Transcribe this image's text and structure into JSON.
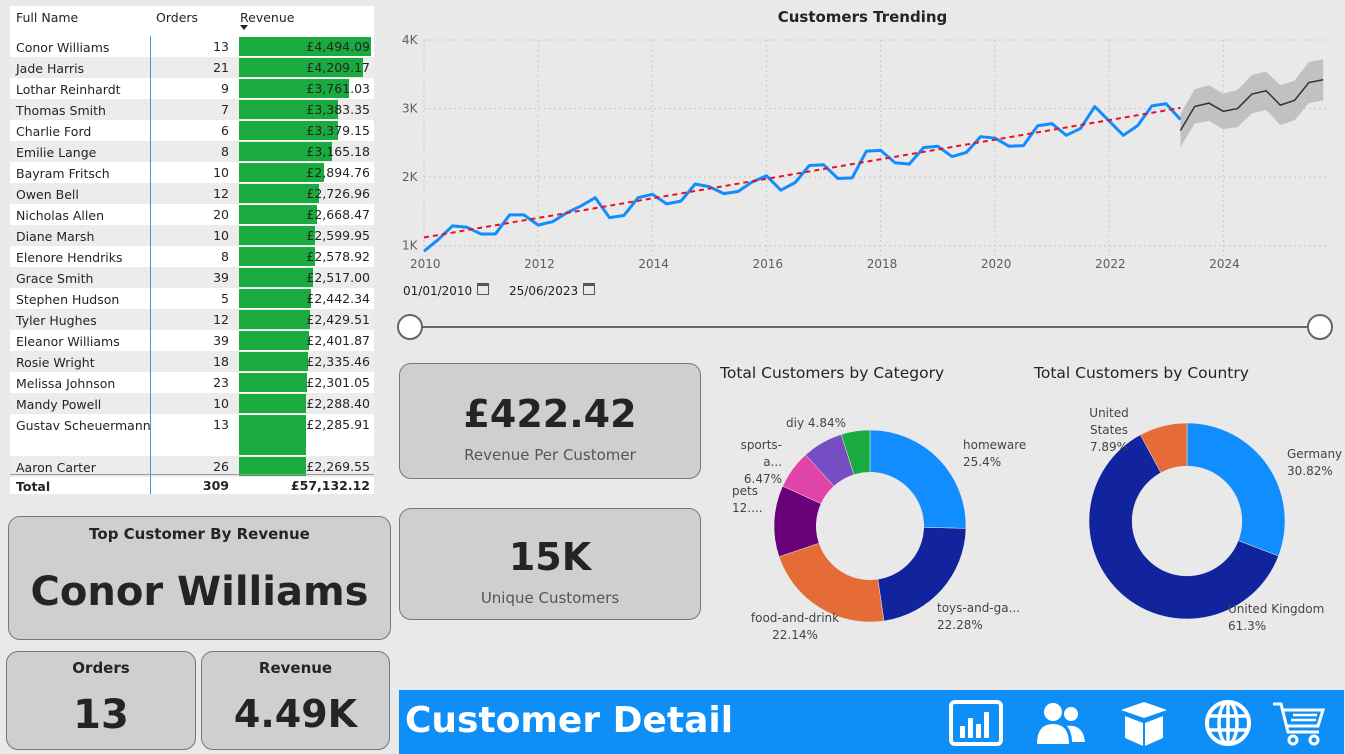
{
  "table": {
    "headers": {
      "name": "Full Name",
      "orders": "Orders",
      "revenue": "Revenue"
    },
    "rows": [
      {
        "name": "Conor Williams",
        "orders": "13",
        "revenue": "£4,494.09",
        "fill": 1.0
      },
      {
        "name": "Jade Harris",
        "orders": "21",
        "revenue": "£4,209.17",
        "fill": 0.937
      },
      {
        "name": "Lothar Reinhardt",
        "orders": "9",
        "revenue": "£3,761.03",
        "fill": 0.837
      },
      {
        "name": "Thomas Smith",
        "orders": "7",
        "revenue": "£3,383.35",
        "fill": 0.753
      },
      {
        "name": "Charlie Ford",
        "orders": "6",
        "revenue": "£3,379.15",
        "fill": 0.752
      },
      {
        "name": "Emilie Lange",
        "orders": "8",
        "revenue": "£3,165.18",
        "fill": 0.704
      },
      {
        "name": "Bayram Fritsch",
        "orders": "10",
        "revenue": "£2,894.76",
        "fill": 0.644
      },
      {
        "name": "Owen Bell",
        "orders": "12",
        "revenue": "£2,726.96",
        "fill": 0.607
      },
      {
        "name": "Nicholas Allen",
        "orders": "20",
        "revenue": "£2,668.47",
        "fill": 0.594
      },
      {
        "name": "Diane Marsh",
        "orders": "10",
        "revenue": "£2,599.95",
        "fill": 0.579
      },
      {
        "name": "Elenore Hendriks",
        "orders": "8",
        "revenue": "£2,578.92",
        "fill": 0.574
      },
      {
        "name": "Grace Smith",
        "orders": "39",
        "revenue": "£2,517.00",
        "fill": 0.56
      },
      {
        "name": "Stephen Hudson",
        "orders": "5",
        "revenue": "£2,442.34",
        "fill": 0.543
      },
      {
        "name": "Tyler Hughes",
        "orders": "12",
        "revenue": "£2,429.51",
        "fill": 0.541
      },
      {
        "name": "Eleanor Williams",
        "orders": "39",
        "revenue": "£2,401.87",
        "fill": 0.534
      },
      {
        "name": "Rosie Wright",
        "orders": "18",
        "revenue": "£2,335.46",
        "fill": 0.52
      },
      {
        "name": "Melissa Johnson",
        "orders": "23",
        "revenue": "£2,301.05",
        "fill": 0.512
      },
      {
        "name": "Mandy Powell",
        "orders": "10",
        "revenue": "£2,288.40",
        "fill": 0.509
      },
      {
        "name": "Gustav Scheuermann",
        "orders": "13",
        "revenue": "£2,285.91",
        "fill": 0.509
      },
      {
        "name": "Aaron Carter",
        "orders": "26",
        "revenue": "£2,269.55",
        "fill": 0.505
      }
    ],
    "total": {
      "label": "Total",
      "orders": "309",
      "revenue": "£57,132.12"
    }
  },
  "top_customer": {
    "title": "Top Customer By Revenue",
    "name": "Conor Williams"
  },
  "orders_card": {
    "title": "Orders",
    "value": "13"
  },
  "revenue_card": {
    "title": "Revenue",
    "value": "4.49K"
  },
  "rpc_card": {
    "value": "£422.42",
    "label": "Revenue Per Customer"
  },
  "unique_card": {
    "value": "15K",
    "label": "Unique Customers"
  },
  "line_chart": {
    "title": "Customers Trending",
    "date_start": "01/01/2010",
    "date_end": "25/06/2023"
  },
  "category_donut": {
    "title": "Total Customers by Category",
    "labels": {
      "homeware": [
        "homeware",
        "25.4%"
      ],
      "toys": [
        "toys-and-ga...",
        "22.28%"
      ],
      "food": [
        "food-and-drink",
        "22.14%"
      ],
      "pets": [
        "pets",
        "12...."
      ],
      "sports": [
        "sports-a...",
        "6.47%"
      ],
      "diy": [
        "diy 4.84%"
      ]
    }
  },
  "country_donut": {
    "title": "Total Customers by Country",
    "labels": {
      "us": [
        "United States",
        "7.89%"
      ],
      "de": [
        "Germany",
        "30.82%"
      ],
      "uk": [
        "United Kingdom",
        "61.3%"
      ]
    }
  },
  "footer": {
    "title": "Customer Detail"
  },
  "chart_data": [
    {
      "type": "line",
      "title": "Customers Trending",
      "xlabel": "",
      "ylabel": "",
      "x_ticks": [
        "2010",
        "2012",
        "2014",
        "2016",
        "2018",
        "2020",
        "2022",
        "2024"
      ],
      "y_ticks": [
        "1K",
        "2K",
        "3K",
        "4K"
      ],
      "xlim": [
        2010,
        2025.8
      ],
      "ylim": [
        850,
        4000
      ],
      "grid": true,
      "series": [
        {
          "x": [
            2010.0,
            2010.25,
            2010.5,
            2010.75,
            2011.0,
            2011.25,
            2011.5,
            2011.75,
            2012.0,
            2012.25,
            2012.5,
            2012.75,
            2013.0,
            2013.25,
            2013.5,
            2013.75,
            2014.0,
            2014.25,
            2014.5,
            2014.75,
            2015.0,
            2015.25,
            2015.5,
            2015.75,
            2016.0,
            2016.25,
            2016.5,
            2016.75,
            2017.0,
            2017.25,
            2017.5,
            2017.75,
            2018.0,
            2018.25,
            2018.5,
            2018.75,
            2019.0,
            2019.25,
            2019.5,
            2019.75,
            2020.0,
            2020.25,
            2020.5,
            2020.75,
            2021.0,
            2021.25,
            2021.5,
            2021.75,
            2022.0,
            2022.25,
            2022.5,
            2022.75,
            2023.0,
            2023.25
          ],
          "values": [
            920,
            1090,
            1290,
            1270,
            1170,
            1170,
            1450,
            1450,
            1300,
            1350,
            1480,
            1580,
            1700,
            1410,
            1440,
            1700,
            1750,
            1610,
            1650,
            1900,
            1860,
            1760,
            1790,
            1930,
            2020,
            1810,
            1920,
            2170,
            2180,
            1980,
            1990,
            2380,
            2390,
            2210,
            2190,
            2430,
            2450,
            2300,
            2360,
            2590,
            2570,
            2450,
            2460,
            2750,
            2780,
            2610,
            2710,
            3030,
            2820,
            2610,
            2750,
            3040,
            3070,
            2840
          ]
        },
        {
          "x": [
            2010.0,
            2023.25
          ],
          "values": [
            1120,
            3010
          ]
        },
        {
          "x": [
            2023.25,
            2023.5,
            2023.75,
            2024.0,
            2024.25,
            2024.5,
            2024.75,
            2025.0,
            2025.25,
            2025.5,
            2025.75
          ],
          "values": [
            2680,
            3030,
            3080,
            2960,
            3000,
            3210,
            3260,
            3050,
            3120,
            3380,
            3420
          ],
          "band": [
            240,
            250,
            260,
            260,
            270,
            280,
            280,
            290,
            290,
            300,
            300
          ]
        }
      ]
    },
    {
      "type": "pie",
      "title": "Total Customers by Category",
      "categories": [
        "homeware",
        "toys-and-ga...",
        "food-and-drink",
        "pets",
        "sports-a...",
        "diy"
      ],
      "values": [
        25.4,
        22.28,
        22.14,
        12.0,
        6.47,
        4.84
      ],
      "colors": [
        "#118dff",
        "#12239e",
        "#e66c37",
        "#6b007b",
        "#e044a7",
        "#744ec2",
        "#1aab40"
      ],
      "slice_values": [
        25.4,
        22.28,
        22.14,
        12.0,
        6.47,
        6.87,
        4.84
      ]
    },
    {
      "type": "pie",
      "title": "Total Customers by Country",
      "categories": [
        "Germany",
        "United Kingdom",
        "United States"
      ],
      "values": [
        30.82,
        61.3,
        7.89
      ],
      "colors": [
        "#118dff",
        "#12239e",
        "#e66c37"
      ]
    }
  ]
}
